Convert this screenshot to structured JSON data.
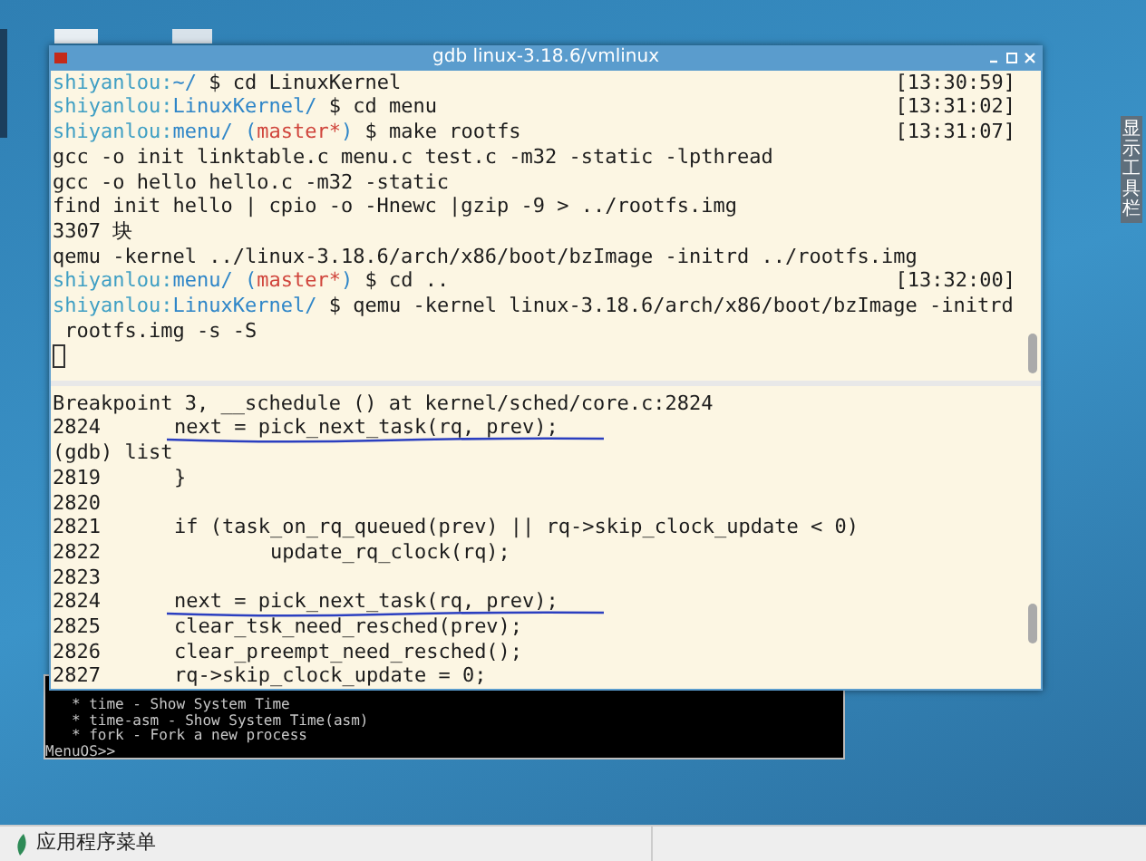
{
  "side_tab": {
    "label": "显示工具栏"
  },
  "terminal": {
    "title": "gdb linux-3.18.6/vmlinux",
    "top_lines": [
      {
        "segments": [
          {
            "kind": "host",
            "text": "shiyanlou"
          },
          {
            "kind": "host",
            "text": ":"
          },
          {
            "kind": "path",
            "text": "~/"
          },
          {
            "kind": "plain",
            "text": " $ cd LinuxKernel"
          }
        ],
        "time": "[13:30:59]"
      },
      {
        "segments": [
          {
            "kind": "host",
            "text": "shiyanlou"
          },
          {
            "kind": "host",
            "text": ":"
          },
          {
            "kind": "path",
            "text": "LinuxKernel/"
          },
          {
            "kind": "plain",
            "text": " $ cd menu"
          }
        ],
        "time": "[13:31:02]"
      },
      {
        "segments": [
          {
            "kind": "host",
            "text": "shiyanlou"
          },
          {
            "kind": "host",
            "text": ":"
          },
          {
            "kind": "path",
            "text": "menu/"
          },
          {
            "kind": "path",
            "text": " ("
          },
          {
            "kind": "branch",
            "text": "master*"
          },
          {
            "kind": "path",
            "text": ")"
          },
          {
            "kind": "plain",
            "text": " $ make rootfs"
          }
        ],
        "time": "[13:31:07]"
      },
      {
        "segments": [
          {
            "kind": "plain",
            "text": "gcc -o init linktable.c menu.c test.c -m32 -static -lpthread"
          }
        ]
      },
      {
        "segments": [
          {
            "kind": "plain",
            "text": "gcc -o hello hello.c -m32 -static"
          }
        ]
      },
      {
        "segments": [
          {
            "kind": "plain",
            "text": "find init hello | cpio -o -Hnewc |gzip -9 > ../rootfs.img"
          }
        ]
      },
      {
        "segments": [
          {
            "kind": "plain",
            "text": "3307 块"
          }
        ]
      },
      {
        "segments": [
          {
            "kind": "plain",
            "text": "qemu -kernel ../linux-3.18.6/arch/x86/boot/bzImage -initrd ../rootfs.img"
          }
        ]
      },
      {
        "segments": [
          {
            "kind": "host",
            "text": "shiyanlou"
          },
          {
            "kind": "host",
            "text": ":"
          },
          {
            "kind": "path",
            "text": "menu/"
          },
          {
            "kind": "path",
            "text": " ("
          },
          {
            "kind": "branch",
            "text": "master*"
          },
          {
            "kind": "path",
            "text": ")"
          },
          {
            "kind": "plain",
            "text": " $ cd .."
          }
        ],
        "time": "[13:32:00]"
      },
      {
        "segments": [
          {
            "kind": "host",
            "text": "shiyanlou"
          },
          {
            "kind": "host",
            "text": ":"
          },
          {
            "kind": "path",
            "text": "LinuxKernel/"
          },
          {
            "kind": "plain",
            "text": " $ qemu -kernel linux-3.18.6/arch/x86/boot/bzImage -initrd"
          }
        ]
      },
      {
        "segments": [
          {
            "kind": "plain",
            "text": " rootfs.img -s -S"
          }
        ]
      }
    ],
    "bottom_lines": [
      {
        "text": "Breakpoint 3, __schedule () at kernel/sched/core.c:2824",
        "marked": false
      },
      {
        "number": "2824",
        "text": "next = pick_next_task(rq, prev);",
        "marked": true
      },
      {
        "text": "(gdb) list",
        "marked": false
      },
      {
        "number": "2819",
        "text": "}",
        "marked": false
      },
      {
        "number": "2820"
      },
      {
        "number": "2821",
        "text": "if (task_on_rq_queued(prev) || rq->skip_clock_update < 0)",
        "marked": false
      },
      {
        "number": "2822",
        "text": "        update_rq_clock(rq);",
        "marked": false
      },
      {
        "number": "2823"
      },
      {
        "number": "2824",
        "text": "next = pick_next_task(rq, prev);",
        "marked": true
      },
      {
        "number": "2825",
        "text": "clear_tsk_need_resched(prev);",
        "marked": false
      },
      {
        "number": "2826",
        "text": "clear_preempt_need_resched();",
        "marked": false
      },
      {
        "number": "2827",
        "text": "rq->skip_clock_update = 0;",
        "marked": false
      }
    ]
  },
  "qemu": {
    "lines": [
      "   * time - Show System Time",
      "   * time-asm - Show System Time(asm)",
      "   * fork - Fork a new process",
      "MenuOS>>"
    ]
  },
  "taskbar": {
    "menu_label": "应用程序菜单"
  }
}
